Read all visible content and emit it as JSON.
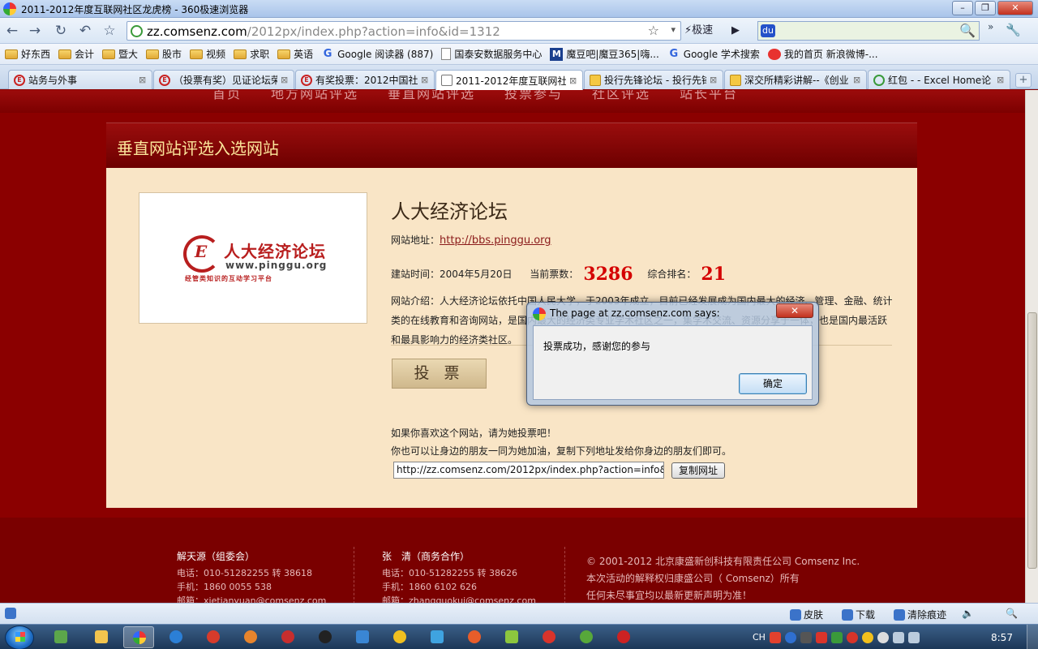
{
  "window": {
    "title": "2011-2012年度互联网社区龙虎榜 - 360极速浏览器",
    "minimize": "–",
    "maximize": "❐",
    "close": "✕"
  },
  "nav": {
    "back": "←",
    "forward": "→",
    "refresh": "↻",
    "undo": "↶",
    "star": "☆",
    "url_domain": "zz.comsenz.com",
    "url_path": "/2012px/index.php?action=info&id=1312",
    "url_star": "☆",
    "url_dropdown": "▾",
    "speed_label": "⚡极速",
    "play": "▶",
    "search_engine": "du",
    "search_placeholder": "",
    "search_icon": "🔍",
    "more": "»",
    "tools": "🔧"
  },
  "bookmarks": [
    {
      "label": "好东西",
      "icon": "folder"
    },
    {
      "label": "会计",
      "icon": "folder"
    },
    {
      "label": "暨大",
      "icon": "folder"
    },
    {
      "label": "股市",
      "icon": "folder"
    },
    {
      "label": "视频",
      "icon": "folder"
    },
    {
      "label": "求职",
      "icon": "folder"
    },
    {
      "label": "英语",
      "icon": "folder"
    },
    {
      "label": "Google 阅读器 (887)",
      "icon": "google"
    },
    {
      "label": "国泰安数据服务中心",
      "icon": "doc"
    },
    {
      "label": "魔豆吧|魔豆365|嗨...",
      "icon": "m"
    },
    {
      "label": "Google 学术搜索",
      "icon": "google"
    },
    {
      "label": "我的首页 新浪微博-...",
      "icon": "weibo"
    }
  ],
  "tabs": [
    {
      "label": "站务与外事",
      "icon": "E",
      "close": "⊠"
    },
    {
      "label": "（投票有奖）见证论坛荣",
      "icon": "E",
      "close": "⊠"
    },
    {
      "label": "有奖投票：2012中国社区",
      "icon": "E",
      "close": "⊠"
    },
    {
      "label": "2011-2012年度互联网社",
      "icon": "",
      "close": "⊠"
    },
    {
      "label": "投行先锋论坛 - 投行先锋",
      "icon": "",
      "close": "⊠"
    },
    {
      "label": "深交所精彩讲解--《创业",
      "icon": "",
      "close": "⊠"
    },
    {
      "label": "红包 - - Excel Home论",
      "icon": "",
      "close": "⊠"
    }
  ],
  "new_tab": "+",
  "page": {
    "top_nav_faded": "首页　　地方网站评选　　垂直网站评选　　投票参与　　社区评选　　站长平台",
    "section_title": "垂直网站评选入选网站",
    "logo": {
      "mark": "E",
      "name": "人大经济论坛",
      "url": "www.pinggu.org",
      "slogan": "经管类知识的互动学习平台"
    },
    "site_name": "人大经济论坛",
    "site_url_label": "网站地址：",
    "site_url": "http://bbs.pinggu.org",
    "founded_label": "建站时间：",
    "founded": "2004年5月20日",
    "votes_label": "当前票数：",
    "votes": "3286",
    "rank_label": "综合排名：",
    "rank": "21",
    "intro": "网站介绍：人大经济论坛依托中国人民大学，于2003年成立，目前已经发展成为国内最大的经济、管理、金融、统计类的在线教育和咨询网站，是国内最大的经济类专业学术社区之一，集学术交流、资源分享于一体，也是国内最活跃和最具影响力的经济类社区。",
    "vote_button": "投 票",
    "share_line1": "如果你喜欢这个网站，请为她投票吧！",
    "share_line2": "你也可以让身边的朋友一同为她加油，复制下列地址发给你身边的朋友们即可。",
    "share_url": "http://zz.comsenz.com/2012px/index.php?action=info&id=1312",
    "copy_button": "复制网址"
  },
  "footer": {
    "col1": {
      "head": "解天源（组委会）",
      "phone": "电话：010-51282255 转 38618",
      "mobile": "手机：1860 0055 538",
      "email": "邮箱：xietianyuan@comsenz.com"
    },
    "col2": {
      "head": "张　清（商务合作）",
      "phone": "电话：010-51282255 转 38626",
      "mobile": "手机：1860 6102 626",
      "email": "邮箱：zhangguokui@comsenz.com"
    },
    "col3": {
      "line1": "© 2001-2012 北京康盛新创科技有限责任公司 Comsenz Inc.",
      "line2": "本次活动的解释权归康盛公司（ Comsenz）所有",
      "line3": "任何未尽事宜均以最新更新声明为准！"
    }
  },
  "dialog": {
    "title": "The page at zz.comsenz.com says:",
    "close": "✕",
    "message": "投票成功，感谢您的参与",
    "ok": "确定"
  },
  "statusbar": {
    "skin": "皮肤",
    "download": "下载",
    "clear": "清除痕迹",
    "volume": "🔈",
    "zoom": "🔍"
  },
  "taskbar": {
    "ime": "CH",
    "clock": "8:57"
  },
  "colors": {
    "page_bg": "#8b0000",
    "panel_bg": "#f9e5c6",
    "accent_red": "#d40000",
    "title_gold": "#fbe59a"
  }
}
